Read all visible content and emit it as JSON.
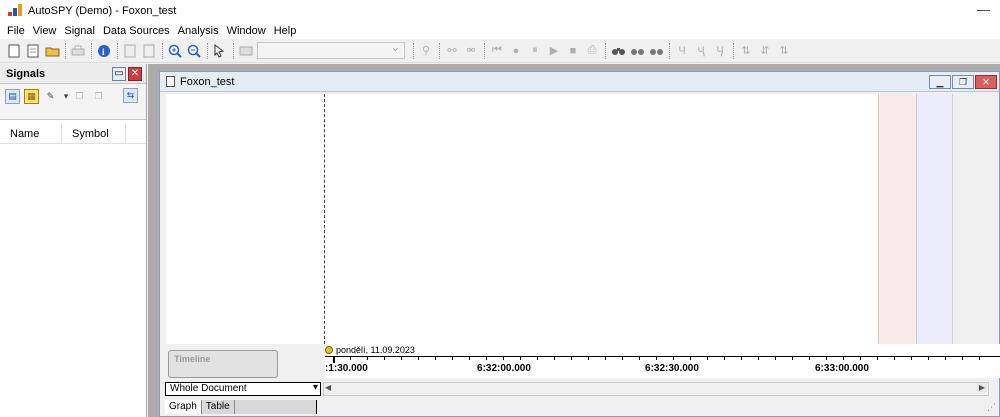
{
  "window": {
    "title": "AutoSPY (Demo) - Foxon_test",
    "minimize_glyph": "—"
  },
  "menu": [
    "File",
    "View",
    "Signal",
    "Data Sources",
    "Analysis",
    "Window",
    "Help"
  ],
  "toolbar": {
    "icons": [
      "new-icon",
      "open-icon",
      "folder-icon",
      "print-icon",
      "info-icon",
      "page-setup-icon",
      "zoom-in-icon",
      "zoom-out-icon",
      "pointer-icon",
      "record-icon",
      "play-icon",
      "stop-icon",
      "binoculars-icon",
      "cursor-icon"
    ]
  },
  "signals_panel": {
    "title": "Signals",
    "columns": [
      "Name",
      "Symbol"
    ]
  },
  "document": {
    "title": "Foxon_test",
    "timeline_label": "Timeline",
    "date": "pondělí, 11.09.2023",
    "ticks": [
      ":1:30.000",
      "6:32:00.000",
      "6:32:30.000",
      "6:33:00.000"
    ],
    "view_select": "Whole Document",
    "tabs": [
      "Graph",
      "Table"
    ]
  },
  "colors": {
    "band_red": "#fbeaea",
    "band_blue": "#ececfa",
    "mdi_background": "#ababab"
  }
}
